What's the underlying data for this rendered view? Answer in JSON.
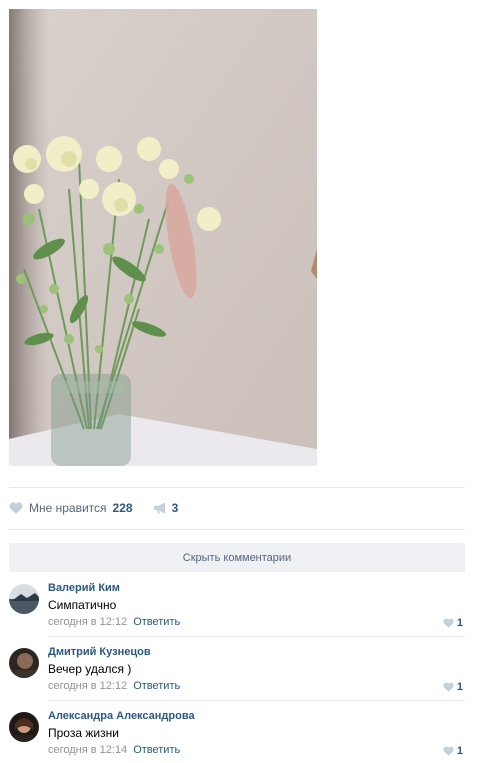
{
  "post": {
    "photo": {
      "subject": "carnations in glass jar"
    }
  },
  "actions": {
    "like_label": "Мне нравится",
    "like_count": "228",
    "share_count": "3"
  },
  "hide_comments_label": "Скрыть комментарии",
  "comments": [
    {
      "author": "Валерий Ким",
      "text": "Симпатично",
      "time": "сегодня в 12:12",
      "reply_label": "Ответить",
      "likes": "1"
    },
    {
      "author": "Дмитрий Кузнецов",
      "text": "Вечер удался )",
      "time": "сегодня в 12:12",
      "reply_label": "Ответить",
      "likes": "1"
    },
    {
      "author": "Александра Александрова",
      "text": "Проза жизни",
      "time": "сегодня в 12:14",
      "reply_label": "Ответить",
      "likes": "1"
    }
  ],
  "colors": {
    "link": "#2a5885",
    "muted": "#939393",
    "icon": "#c5d0db",
    "bar_bg": "#eef0f3"
  }
}
